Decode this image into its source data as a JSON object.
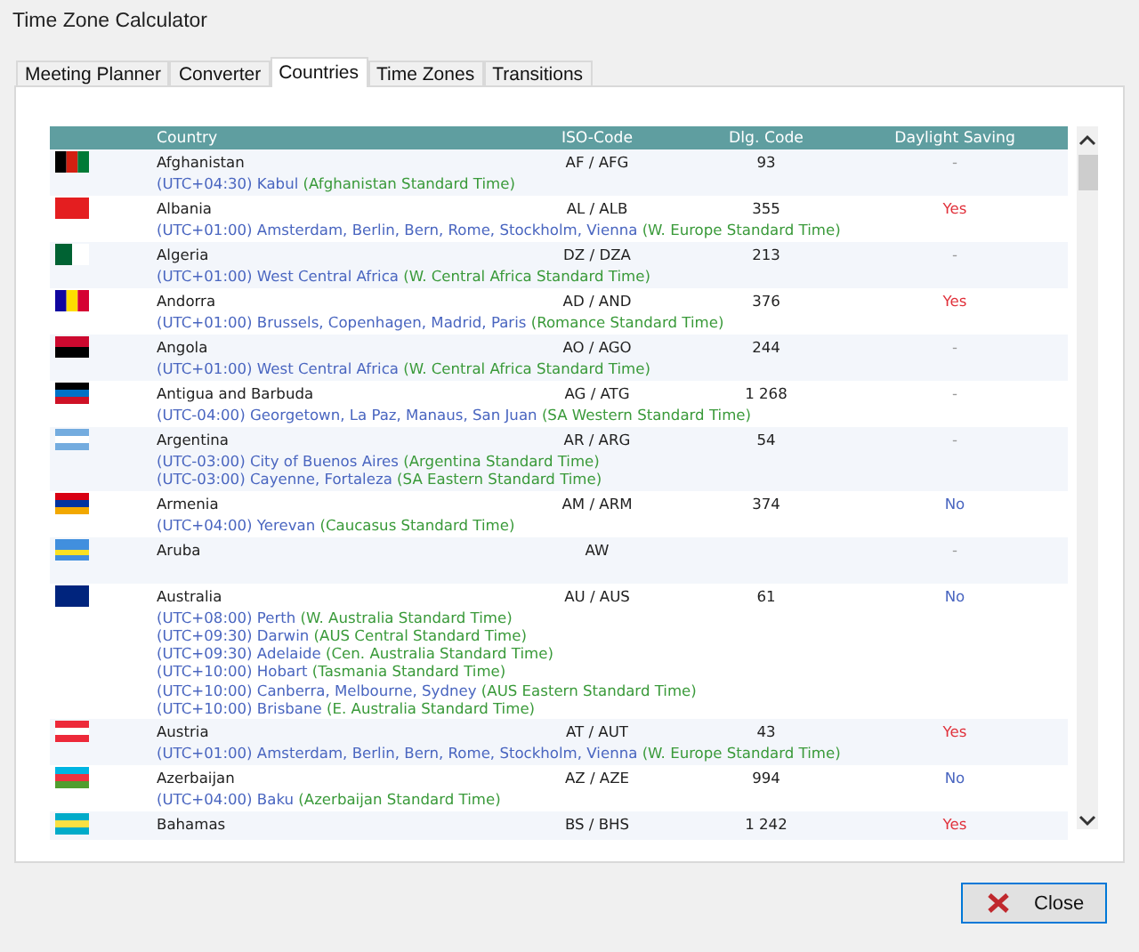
{
  "window": {
    "title": "Time Zone Calculator"
  },
  "tabs": [
    {
      "label": "Meeting Planner",
      "selected": false
    },
    {
      "label": "Converter",
      "selected": false
    },
    {
      "label": "Countries",
      "selected": true
    },
    {
      "label": "Time Zones",
      "selected": false
    },
    {
      "label": "Transitions",
      "selected": false
    }
  ],
  "table": {
    "columns": [
      "Country",
      "ISO-Code",
      "Dlg. Code",
      "Daylight Saving"
    ],
    "rows": [
      {
        "country": "Afghanistan",
        "iso": "AF / AFG",
        "dialing": "93",
        "daylight_saving": {
          "text": "-",
          "kind": "none"
        },
        "flag": {
          "kind": "vertical",
          "stripes": [
            {
              "color": "#000000"
            },
            {
              "color": "#d32011"
            },
            {
              "color": "#007a36"
            }
          ]
        },
        "zones": [
          {
            "zone": "(UTC+04:30) Kabul",
            "standard": "(Afghanistan Standard Time)"
          }
        ]
      },
      {
        "country": "Albania",
        "iso": "AL / ALB",
        "dialing": "355",
        "daylight_saving": {
          "text": "Yes",
          "kind": "yes"
        },
        "flag": {
          "kind": "vertical",
          "stripes": [
            {
              "color": "#e41e20"
            }
          ]
        },
        "zones": [
          {
            "zone": "(UTC+01:00) Amsterdam, Berlin, Bern, Rome, Stockholm, Vienna",
            "standard": "(W. Europe Standard Time)"
          }
        ]
      },
      {
        "country": "Algeria",
        "iso": "DZ / DZA",
        "dialing": "213",
        "daylight_saving": {
          "text": "-",
          "kind": "none"
        },
        "flag": {
          "kind": "vertical",
          "stripes": [
            {
              "color": "#006233"
            },
            {
              "color": "#ffffff"
            }
          ]
        },
        "zones": [
          {
            "zone": "(UTC+01:00) West Central Africa",
            "standard": "(W. Central Africa Standard Time)"
          }
        ]
      },
      {
        "country": "Andorra",
        "iso": "AD / AND",
        "dialing": "376",
        "daylight_saving": {
          "text": "Yes",
          "kind": "yes"
        },
        "flag": {
          "kind": "vertical",
          "stripes": [
            {
              "color": "#10069f"
            },
            {
              "color": "#fedd00"
            },
            {
              "color": "#d50032"
            }
          ]
        },
        "zones": [
          {
            "zone": "(UTC+01:00) Brussels, Copenhagen, Madrid, Paris",
            "standard": "(Romance Standard Time)"
          }
        ]
      },
      {
        "country": "Angola",
        "iso": "AO / AGO",
        "dialing": "244",
        "daylight_saving": {
          "text": "-",
          "kind": "none"
        },
        "flag": {
          "kind": "horizontal",
          "stripes": [
            {
              "color": "#cc092f"
            },
            {
              "color": "#000000"
            }
          ]
        },
        "zones": [
          {
            "zone": "(UTC+01:00) West Central Africa",
            "standard": "(W. Central Africa Standard Time)"
          }
        ]
      },
      {
        "country": "Antigua and Barbuda",
        "iso": "AG / ATG",
        "dialing": "1 268",
        "daylight_saving": {
          "text": "-",
          "kind": "none"
        },
        "flag": {
          "kind": "horizontal",
          "stripes": [
            {
              "color": "#000000"
            },
            {
              "color": "#0072c6"
            },
            {
              "color": "#ce1126"
            }
          ]
        },
        "zones": [
          {
            "zone": "(UTC-04:00) Georgetown, La Paz, Manaus, San Juan",
            "standard": "(SA Western Standard Time)"
          }
        ]
      },
      {
        "country": "Argentina",
        "iso": "AR / ARG",
        "dialing": "54",
        "daylight_saving": {
          "text": "-",
          "kind": "none"
        },
        "flag": {
          "kind": "horizontal",
          "stripes": [
            {
              "color": "#74acdf"
            },
            {
              "color": "#ffffff"
            },
            {
              "color": "#74acdf"
            }
          ]
        },
        "zones": [
          {
            "zone": "(UTC-03:00) City of Buenos Aires",
            "standard": "(Argentina Standard Time)"
          },
          {
            "zone": "(UTC-03:00) Cayenne, Fortaleza",
            "standard": "(SA Eastern Standard Time)"
          }
        ]
      },
      {
        "country": "Armenia",
        "iso": "AM / ARM",
        "dialing": "374",
        "daylight_saving": {
          "text": "No",
          "kind": "no"
        },
        "flag": {
          "kind": "horizontal",
          "stripes": [
            {
              "color": "#d90012"
            },
            {
              "color": "#0033a0"
            },
            {
              "color": "#f2a800"
            }
          ]
        },
        "zones": [
          {
            "zone": "(UTC+04:00) Yerevan",
            "standard": "(Caucasus Standard Time)"
          }
        ]
      },
      {
        "country": "Aruba",
        "iso": "AW",
        "daylight_saving": {
          "text": "-",
          "kind": "none"
        },
        "flag": {
          "kind": "horizontal",
          "stripes": [
            {
              "color": "#418fde"
            },
            {
              "color": "#418fde"
            },
            {
              "color": "#fbe122"
            },
            {
              "color": "#418fde"
            }
          ]
        },
        "zones": []
      },
      {
        "country": "Australia",
        "iso": "AU / AUS",
        "dialing": "61",
        "daylight_saving": {
          "text": "No",
          "kind": "no"
        },
        "flag": {
          "kind": "horizontal",
          "stripes": [
            {
              "color": "#00247d"
            }
          ]
        },
        "zones": [
          {
            "zone": "(UTC+08:00) Perth",
            "standard": "(W. Australia Standard Time)"
          },
          {
            "zone": "(UTC+09:30) Darwin",
            "standard": "(AUS Central Standard Time)"
          },
          {
            "zone": "(UTC+09:30) Adelaide",
            "standard": "(Cen. Australia Standard Time)"
          },
          {
            "zone": "(UTC+10:00) Hobart",
            "standard": "(Tasmania Standard Time)"
          },
          {
            "zone": "(UTC+10:00) Canberra, Melbourne, Sydney",
            "standard": "(AUS Eastern Standard Time)"
          },
          {
            "zone": "(UTC+10:00) Brisbane",
            "standard": "(E. Australia Standard Time)"
          }
        ]
      },
      {
        "country": "Austria",
        "iso": "AT / AUT",
        "dialing": "43",
        "daylight_saving": {
          "text": "Yes",
          "kind": "yes"
        },
        "flag": {
          "kind": "horizontal",
          "stripes": [
            {
              "color": "#ed2939"
            },
            {
              "color": "#ffffff"
            },
            {
              "color": "#ed2939"
            }
          ]
        },
        "zones": [
          {
            "zone": "(UTC+01:00) Amsterdam, Berlin, Bern, Rome, Stockholm, Vienna",
            "standard": "(W. Europe Standard Time)"
          }
        ]
      },
      {
        "country": "Azerbaijan",
        "iso": "AZ / AZE",
        "dialing": "994",
        "daylight_saving": {
          "text": "No",
          "kind": "no"
        },
        "flag": {
          "kind": "horizontal",
          "stripes": [
            {
              "color": "#00b5e2"
            },
            {
              "color": "#ef3340"
            },
            {
              "color": "#509e2f"
            }
          ]
        },
        "zones": [
          {
            "zone": "(UTC+04:00) Baku",
            "standard": "(Azerbaijan Standard Time)"
          }
        ]
      },
      {
        "country": "Bahamas",
        "iso": "BS / BHS",
        "dialing": "1 242",
        "daylight_saving": {
          "text": "Yes",
          "kind": "yes"
        },
        "flag": {
          "kind": "horizontal",
          "stripes": [
            {
              "color": "#00abc9"
            },
            {
              "color": "#fae042"
            },
            {
              "color": "#00abc9"
            }
          ]
        },
        "zones": []
      }
    ]
  },
  "buttons": [
    {
      "label": "Close"
    }
  ]
}
